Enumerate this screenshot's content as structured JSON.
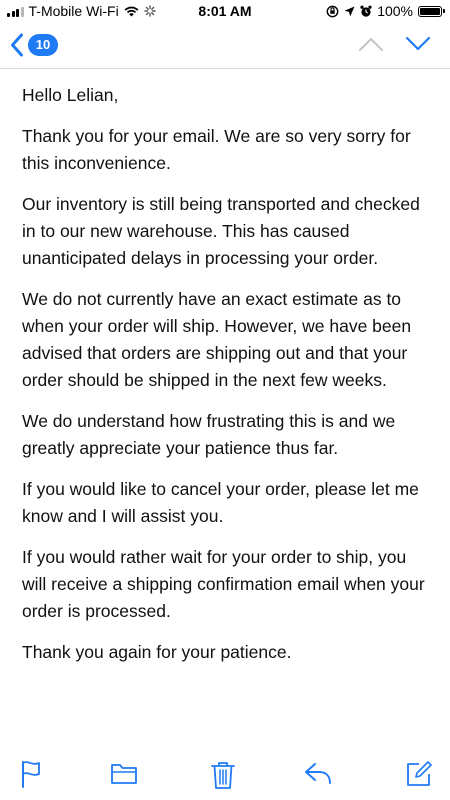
{
  "status_bar": {
    "carrier": "T-Mobile Wi-Fi",
    "time": "8:01 AM",
    "battery": "100%",
    "signal_bars_active": 3,
    "battery_level": 1.0
  },
  "nav": {
    "back_count": "10",
    "accent_color": "#1f7bf3"
  },
  "email": {
    "greeting": "Hello Lelian,",
    "paragraphs": [
      "Thank you for your email. We are so very sorry for this inconvenience.",
      "Our inventory is still being transported and checked in to our new warehouse. This has caused unanticipated delays in processing your order.",
      "We do not currently have an exact estimate as to when your order will ship. However, we have been advised that orders are shipping out and that your order should be shipped in the next few weeks.",
      "We do understand how frustrating this is and we greatly appreciate your patience thus far.",
      "If you would like to cancel your order, please let me know and I will assist you.",
      "If you would rather wait for your order to ship, you will receive a shipping confirmation email when your order is processed.",
      "Thank you again for your patience."
    ]
  },
  "toolbar": {
    "icons": [
      "flag-icon",
      "folder-icon",
      "trash-icon",
      "reply-icon",
      "compose-icon"
    ]
  }
}
